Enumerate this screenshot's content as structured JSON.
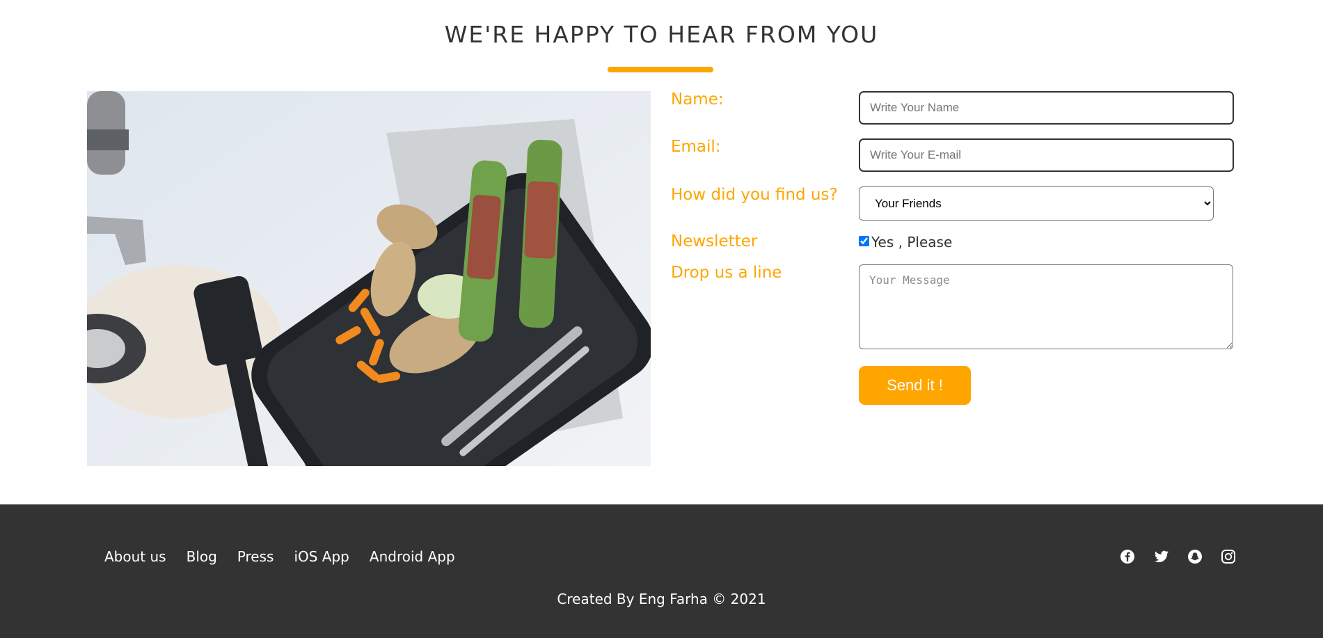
{
  "section": {
    "heading": "WE'RE HAPPY TO HEAR FROM YOU"
  },
  "form": {
    "name_label": "Name:",
    "name_placeholder": "Write Your Name",
    "email_label": "Email:",
    "email_placeholder": "Write Your E-mail",
    "source_label": "How did you find us?",
    "source_selected": "Your Friends",
    "newsletter_label": "Newsletter",
    "newsletter_checked": true,
    "newsletter_option": "Yes , Please",
    "message_label": "Drop us a line",
    "message_placeholder": "Your Message",
    "submit_label": "Send it !"
  },
  "footer": {
    "links": [
      "About us",
      "Blog",
      "Press",
      "iOS App",
      "Android App"
    ],
    "social_icons": [
      "facebook-icon",
      "twitter-icon",
      "snapchat-icon",
      "instagram-icon"
    ],
    "copyright": "Created By Eng Farha © 2021"
  },
  "colors": {
    "accent": "#ffa500",
    "footer_bg": "#333333",
    "heading_text": "#333333"
  }
}
